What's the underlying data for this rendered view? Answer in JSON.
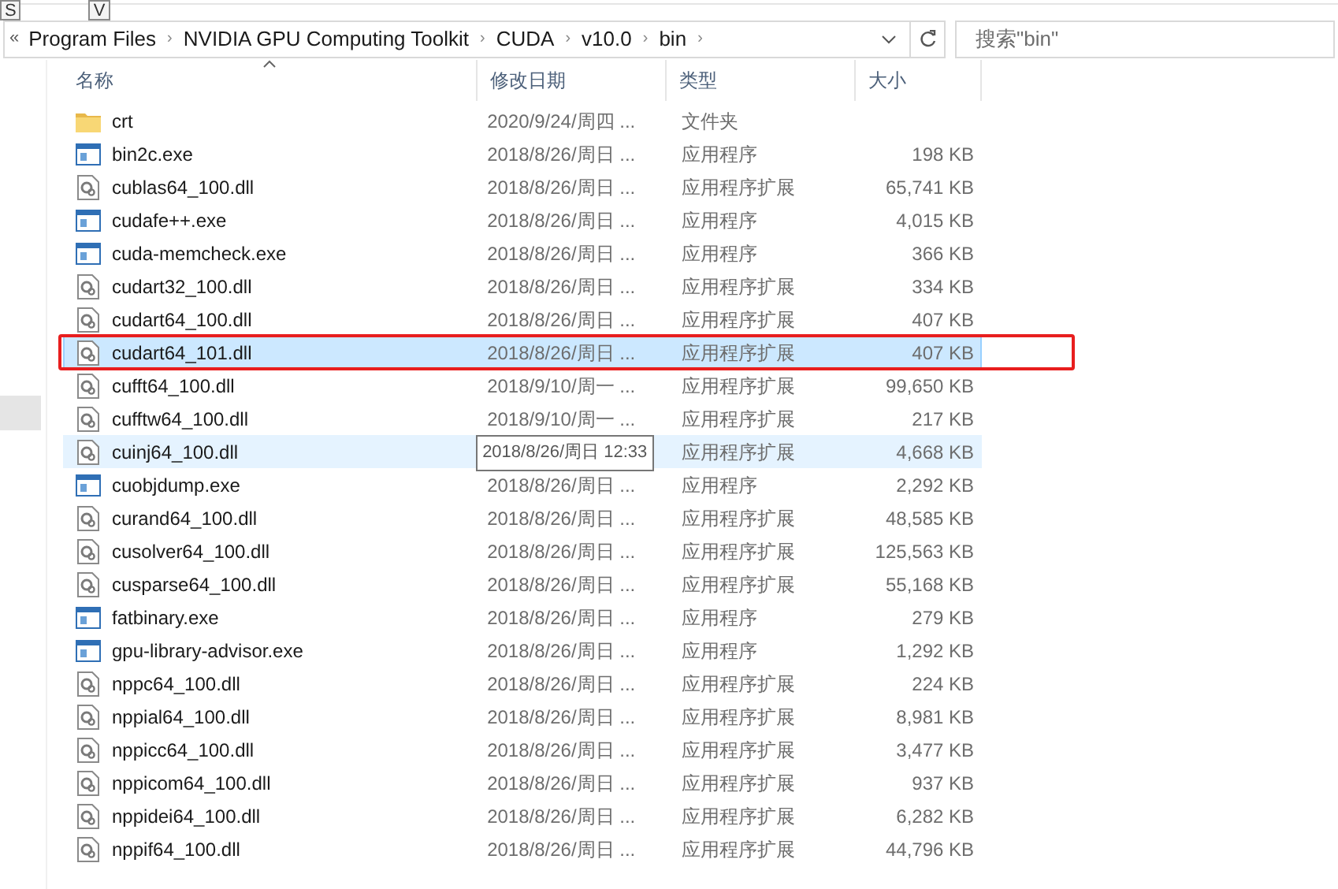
{
  "keytips": [
    "S",
    "V"
  ],
  "breadcrumb": {
    "overflow": "«",
    "separator": "›",
    "parts": [
      "Program Files",
      "NVIDIA GPU Computing Toolkit",
      "CUDA",
      "v10.0",
      "bin"
    ]
  },
  "search": {
    "placeholder": "搜索\"bin\""
  },
  "columns": [
    {
      "label": "名称",
      "sorted": true
    },
    {
      "label": "修改日期",
      "sorted": false
    },
    {
      "label": "类型",
      "sorted": false
    },
    {
      "label": "大小",
      "sorted": false
    }
  ],
  "files": [
    {
      "kind": "folder",
      "name": "crt",
      "date": "2020/9/24/周四 ...",
      "type": "文件夹",
      "selected": false,
      "hot": false
    },
    {
      "kind": "exe",
      "name": "bin2c.exe",
      "date": "2018/8/26/周日 ...",
      "type": "应用程序",
      "size": "198 KB",
      "selected": false,
      "hot": false
    },
    {
      "kind": "dll",
      "name": "cublas64_100.dll",
      "date": "2018/8/26/周日 ...",
      "type": "应用程序扩展",
      "size": "65,741 KB",
      "selected": false,
      "hot": false
    },
    {
      "kind": "exe",
      "name": "cudafe++.exe",
      "date": "2018/8/26/周日 ...",
      "type": "应用程序",
      "size": "4,015 KB",
      "selected": false,
      "hot": false
    },
    {
      "kind": "exe",
      "name": "cuda-memcheck.exe",
      "date": "2018/8/26/周日 ...",
      "type": "应用程序",
      "size": "366 KB",
      "selected": false,
      "hot": false
    },
    {
      "kind": "dll",
      "name": "cudart32_100.dll",
      "date": "2018/8/26/周日 ...",
      "type": "应用程序扩展",
      "size": "334 KB",
      "selected": false,
      "hot": false
    },
    {
      "kind": "dll",
      "name": "cudart64_100.dll",
      "date": "2018/8/26/周日 ...",
      "type": "应用程序扩展",
      "size": "407 KB",
      "selected": false,
      "hot": false
    },
    {
      "kind": "dll",
      "name": "cudart64_101.dll",
      "date": "2018/8/26/周日 ...",
      "type": "应用程序扩展",
      "size": "407 KB",
      "selected": true,
      "hot": false,
      "annotated": true
    },
    {
      "kind": "dll",
      "name": "cufft64_100.dll",
      "date": "2018/9/10/周一 ...",
      "type": "应用程序扩展",
      "size": "99,650 KB",
      "selected": false,
      "hot": false
    },
    {
      "kind": "dll",
      "name": "cufftw64_100.dll",
      "date": "2018/9/10/周一 ...",
      "type": "应用程序扩展",
      "size": "217 KB",
      "selected": false,
      "hot": false
    },
    {
      "kind": "dll",
      "name": "cuinj64_100.dll",
      "type": "应用程序扩展",
      "size": "4,668 KB",
      "selected": false,
      "hot": true,
      "tooltip": "2018/8/26/周日 12:33"
    },
    {
      "kind": "exe",
      "name": "cuobjdump.exe",
      "date": "2018/8/26/周日 ...",
      "type": "应用程序",
      "size": "2,292 KB",
      "selected": false,
      "hot": false
    },
    {
      "kind": "dll",
      "name": "curand64_100.dll",
      "date": "2018/8/26/周日 ...",
      "type": "应用程序扩展",
      "size": "48,585 KB",
      "selected": false,
      "hot": false
    },
    {
      "kind": "dll",
      "name": "cusolver64_100.dll",
      "date": "2018/8/26/周日 ...",
      "type": "应用程序扩展",
      "size": "125,563 KB",
      "selected": false,
      "hot": false
    },
    {
      "kind": "dll",
      "name": "cusparse64_100.dll",
      "date": "2018/8/26/周日 ...",
      "type": "应用程序扩展",
      "size": "55,168 KB",
      "selected": false,
      "hot": false
    },
    {
      "kind": "exe",
      "name": "fatbinary.exe",
      "date": "2018/8/26/周日 ...",
      "type": "应用程序",
      "size": "279 KB",
      "selected": false,
      "hot": false
    },
    {
      "kind": "exe",
      "name": "gpu-library-advisor.exe",
      "date": "2018/8/26/周日 ...",
      "type": "应用程序",
      "size": "1,292 KB",
      "selected": false,
      "hot": false
    },
    {
      "kind": "dll",
      "name": "nppc64_100.dll",
      "date": "2018/8/26/周日 ...",
      "type": "应用程序扩展",
      "size": "224 KB",
      "selected": false,
      "hot": false
    },
    {
      "kind": "dll",
      "name": "nppial64_100.dll",
      "date": "2018/8/26/周日 ...",
      "type": "应用程序扩展",
      "size": "8,981 KB",
      "selected": false,
      "hot": false
    },
    {
      "kind": "dll",
      "name": "nppicc64_100.dll",
      "date": "2018/8/26/周日 ...",
      "type": "应用程序扩展",
      "size": "3,477 KB",
      "selected": false,
      "hot": false
    },
    {
      "kind": "dll",
      "name": "nppicom64_100.dll",
      "date": "2018/8/26/周日 ...",
      "type": "应用程序扩展",
      "size": "937 KB",
      "selected": false,
      "hot": false
    },
    {
      "kind": "dll",
      "name": "nppidei64_100.dll",
      "date": "2018/8/26/周日 ...",
      "type": "应用程序扩展",
      "size": "6,282 KB",
      "selected": false,
      "hot": false
    },
    {
      "kind": "dll",
      "name": "nppif64_100.dll",
      "date": "2018/8/26/周日 ...",
      "type": "应用程序扩展",
      "size": "44,796 KB",
      "selected": false,
      "hot": false
    }
  ]
}
